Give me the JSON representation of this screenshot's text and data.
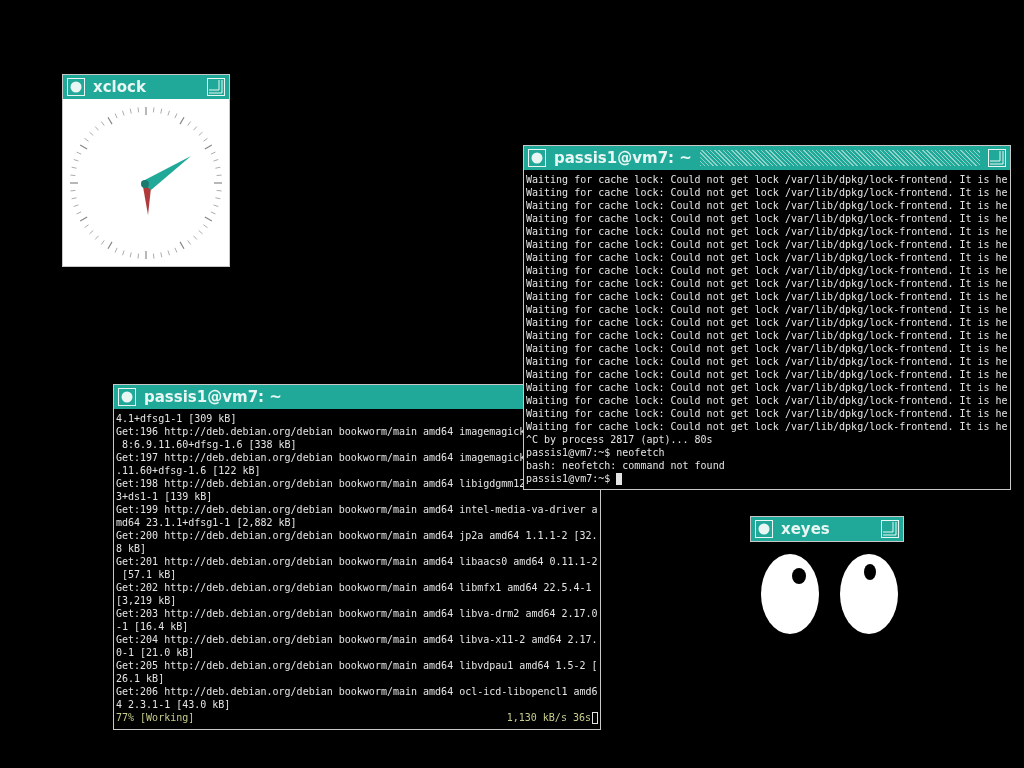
{
  "windows": [
    {
      "kind": "clock",
      "title": "xclock",
      "focused": false
    },
    {
      "kind": "terminal",
      "title": "passis1@vm7: ~",
      "focused": true,
      "lines": [
        "Waiting for cache lock: Could not get lock /var/lib/dpkg/lock-frontend. It is he",
        "Waiting for cache lock: Could not get lock /var/lib/dpkg/lock-frontend. It is he",
        "Waiting for cache lock: Could not get lock /var/lib/dpkg/lock-frontend. It is he",
        "Waiting for cache lock: Could not get lock /var/lib/dpkg/lock-frontend. It is he",
        "Waiting for cache lock: Could not get lock /var/lib/dpkg/lock-frontend. It is he",
        "Waiting for cache lock: Could not get lock /var/lib/dpkg/lock-frontend. It is he",
        "Waiting for cache lock: Could not get lock /var/lib/dpkg/lock-frontend. It is he",
        "Waiting for cache lock: Could not get lock /var/lib/dpkg/lock-frontend. It is he",
        "Waiting for cache lock: Could not get lock /var/lib/dpkg/lock-frontend. It is he",
        "Waiting for cache lock: Could not get lock /var/lib/dpkg/lock-frontend. It is he",
        "Waiting for cache lock: Could not get lock /var/lib/dpkg/lock-frontend. It is he",
        "Waiting for cache lock: Could not get lock /var/lib/dpkg/lock-frontend. It is he",
        "Waiting for cache lock: Could not get lock /var/lib/dpkg/lock-frontend. It is he",
        "Waiting for cache lock: Could not get lock /var/lib/dpkg/lock-frontend. It is he",
        "Waiting for cache lock: Could not get lock /var/lib/dpkg/lock-frontend. It is he",
        "Waiting for cache lock: Could not get lock /var/lib/dpkg/lock-frontend. It is he",
        "Waiting for cache lock: Could not get lock /var/lib/dpkg/lock-frontend. It is he",
        "Waiting for cache lock: Could not get lock /var/lib/dpkg/lock-frontend. It is he",
        "Waiting for cache lock: Could not get lock /var/lib/dpkg/lock-frontend. It is he",
        "Waiting for cache lock: Could not get lock /var/lib/dpkg/lock-frontend. It is he",
        "^C by process 2817 (apt)... 80s",
        "passis1@vm7:~$ neofetch",
        "bash: neofetch: command not found",
        "passis1@vm7:~$"
      ]
    },
    {
      "kind": "terminal",
      "title": "passis1@vm7: ~",
      "focused": false,
      "lines": [
        "4.1+dfsg1-1 [309 kB]",
        "Get:196 http://deb.debian.org/debian bookworm/main amd64 imagemagick",
        " 8:6.9.11.60+dfsg-1.6 [338 kB]",
        "Get:197 http://deb.debian.org/debian bookworm/main amd64 imagemagick",
        ".11.60+dfsg-1.6 [122 kB]",
        "Get:198 http://deb.debian.org/debian bookworm/main amd64 libigdgmm12",
        "3+ds1-1 [139 kB]",
        "Get:199 http://deb.debian.org/debian bookworm/main amd64 intel-media-va-driver a",
        "md64 23.1.1+dfsg1-1 [2,882 kB]",
        "Get:200 http://deb.debian.org/debian bookworm/main amd64 jp2a amd64 1.1.1-2 [32.",
        "8 kB]",
        "Get:201 http://deb.debian.org/debian bookworm/main amd64 libaacs0 amd64 0.11.1-2",
        " [57.1 kB]",
        "Get:202 http://deb.debian.org/debian bookworm/main amd64 libmfx1 amd64 22.5.4-1",
        "[3,219 kB]",
        "Get:203 http://deb.debian.org/debian bookworm/main amd64 libva-drm2 amd64 2.17.0",
        "-1 [16.4 kB]",
        "Get:204 http://deb.debian.org/debian bookworm/main amd64 libva-x11-2 amd64 2.17.",
        "0-1 [21.0 kB]",
        "Get:205 http://deb.debian.org/debian bookworm/main amd64 libvdpau1 amd64 1.5-2 [",
        "26.1 kB]",
        "Get:206 http://deb.debian.org/debian bookworm/main amd64 ocl-icd-libopencl1 amd6",
        "4 2.3.1-1 [43.0 kB]"
      ],
      "status_bar": {
        "left": "77% [Working]",
        "right": "1,130 kB/s 36s"
      }
    },
    {
      "kind": "eyes",
      "title": "xeyes",
      "focused": false
    }
  ]
}
